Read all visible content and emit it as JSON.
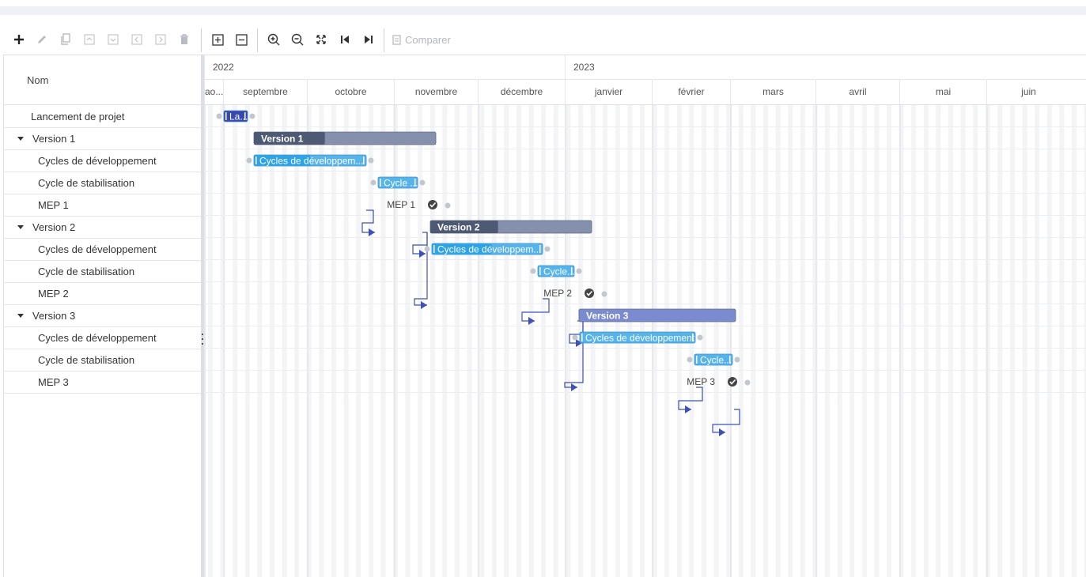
{
  "toolbar": {
    "tools": [
      {
        "name": "add-icon",
        "enabled": true
      },
      {
        "name": "edit-icon",
        "enabled": false
      },
      {
        "name": "copy-icon",
        "enabled": false
      },
      {
        "name": "move-up-icon",
        "enabled": false
      },
      {
        "name": "move-down-icon",
        "enabled": false
      },
      {
        "name": "outdent-icon",
        "enabled": false
      },
      {
        "name": "indent-icon",
        "enabled": false
      },
      {
        "name": "delete-icon",
        "enabled": false
      },
      {
        "name": "expand-all-icon",
        "enabled": true
      },
      {
        "name": "collapse-all-icon",
        "enabled": true
      },
      {
        "name": "zoom-in-icon",
        "enabled": true
      },
      {
        "name": "zoom-out-icon",
        "enabled": true
      },
      {
        "name": "fit-icon",
        "enabled": true
      },
      {
        "name": "go-start-icon",
        "enabled": true
      },
      {
        "name": "go-end-icon",
        "enabled": true
      }
    ],
    "compare_label": "Comparer"
  },
  "grid": {
    "column_header": "Nom",
    "rows": [
      {
        "label": "Lancement de projet",
        "level": 0,
        "type": "task"
      },
      {
        "label": "Version 1",
        "level": 0,
        "type": "summary",
        "expanded": true
      },
      {
        "label": "Cycles de développement",
        "level": 1,
        "type": "task"
      },
      {
        "label": "Cycle de stabilisation",
        "level": 1,
        "type": "task"
      },
      {
        "label": "MEP 1",
        "level": 1,
        "type": "milestone"
      },
      {
        "label": "Version 2",
        "level": 0,
        "type": "summary",
        "expanded": true
      },
      {
        "label": "Cycles de développement",
        "level": 1,
        "type": "task"
      },
      {
        "label": "Cycle de stabilisation",
        "level": 1,
        "type": "task"
      },
      {
        "label": "MEP 2",
        "level": 1,
        "type": "milestone"
      },
      {
        "label": "Version 3",
        "level": 0,
        "type": "summary",
        "expanded": true
      },
      {
        "label": "Cycles de développement",
        "level": 1,
        "type": "task"
      },
      {
        "label": "Cycle de stabilisation",
        "level": 1,
        "type": "task"
      },
      {
        "label": "MEP 3",
        "level": 1,
        "type": "milestone"
      }
    ]
  },
  "timeline": {
    "years": [
      "2022",
      "2023"
    ],
    "months": [
      "ao...",
      "septembre",
      "octobre",
      "novembre",
      "décembre",
      "janvier",
      "février",
      "mars",
      "avril",
      "mai",
      "juin"
    ],
    "bars": [
      {
        "row": 0,
        "label": "La...",
        "type": "task",
        "progress": 0
      },
      {
        "row": 1,
        "label": "Version 1",
        "type": "summary",
        "progress": 0.39
      },
      {
        "row": 2,
        "label": "Cycles de développem...",
        "type": "task",
        "progress": 0.5
      },
      {
        "row": 3,
        "label": "Cycle ...",
        "type": "task",
        "progress": 0
      },
      {
        "row": 4,
        "label": "MEP 1",
        "type": "milestone"
      },
      {
        "row": 5,
        "label": "Version 2",
        "type": "summary",
        "progress": 0.42
      },
      {
        "row": 6,
        "label": "Cycles de développem...",
        "type": "task",
        "progress": 0.54
      },
      {
        "row": 7,
        "label": "Cycle...",
        "type": "task",
        "progress": 0
      },
      {
        "row": 8,
        "label": "MEP 2",
        "type": "milestone"
      },
      {
        "row": 9,
        "label": "Version 3",
        "type": "summary",
        "progress": 0
      },
      {
        "row": 10,
        "label": "Cycles de développement",
        "type": "task",
        "progress": 0
      },
      {
        "row": 11,
        "label": "Cycle...",
        "type": "task",
        "progress": 0
      },
      {
        "row": 12,
        "label": "MEP 3",
        "type": "milestone"
      }
    ],
    "colors": {
      "task": "#57b4ea",
      "task_progress": "#2ea3e6",
      "task_selected": "#3949ab",
      "summary": "#8591ac",
      "summary_progress": "#4e5a73",
      "summary_v3": "#7b8bd0",
      "link": "#3f51b5",
      "milestone": "#444444"
    }
  }
}
